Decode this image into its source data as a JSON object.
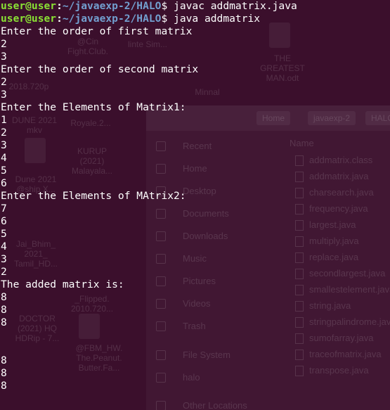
{
  "colors": {
    "terminal_background": "#3b0f2c",
    "prompt_user": "#8ae234",
    "prompt_path": "#729fcf",
    "text": "#ffffff"
  },
  "prompt": {
    "user_host": "user@user",
    "separator": ":",
    "path": "~/javaexp-2/HALO",
    "symbol": "$"
  },
  "commands": [
    " javac addmatrix.java",
    " java addmatrix"
  ],
  "output_lines": [
    "Enter the order of first matrix",
    "2",
    "3",
    "Enter the order of second matrix",
    "2",
    "3",
    "Enter the Elements of Matrix1:",
    "1",
    "2",
    "3",
    "4",
    "5",
    "6",
    "Enter the Elements of MAtrix2:",
    "7",
    "6",
    "5",
    "4",
    "3",
    "2",
    "The added matrix is:",
    "8",
    "8",
    "8",
    "",
    "",
    "8",
    "8",
    "8"
  ],
  "background_desktop": {
    "desktop_items": [
      "@Cin\nFight.Club.",
      "linte Sim...",
      "THE\nGREATEST\nMAN.odt",
      "2018.720p",
      "Minnal",
      "DUNE 2021\nmkv",
      "Royale.2...",
      "KURUP\n(2021)\nMalayala...",
      "Dune 2021\n@ship X...",
      "Jai_Bhim_\n2021_\nTamil_HD...",
      "_Flipped.\n2010.720...",
      "DOCTOR\n(2021) HQ\nHDRip - 7...",
      "@FBM_HW.\nThe.Peanut.\nButter.Fa..."
    ],
    "file_manager": {
      "nav_path_segments": [
        "Home",
        "javaexp-2",
        "HALO"
      ],
      "sidebar": [
        "Recent",
        "Home",
        "Desktop",
        "Documents",
        "Downloads",
        "Music",
        "Pictures",
        "Videos",
        "Trash",
        "File System",
        "halo",
        "Other Locations"
      ],
      "column_header": "Name",
      "files": [
        "addmatrix.class",
        "addmatrix.java",
        "charsearch.java",
        "frequency.java",
        "largest.java",
        "multiply.java",
        "replace.java",
        "secondlargest.java",
        "smallestelement.java",
        "string.java",
        "stringpalindrome.java",
        "sumofarray.java",
        "traceofmatrix.java",
        "transpose.java"
      ]
    }
  }
}
